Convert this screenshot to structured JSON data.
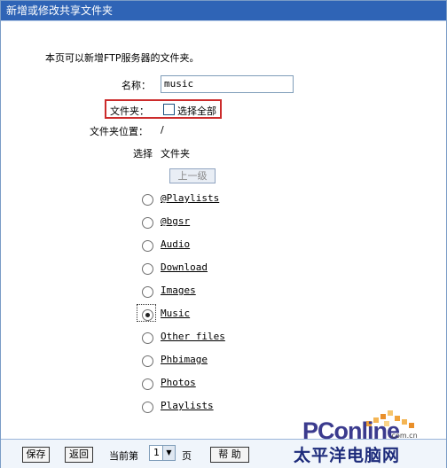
{
  "window": {
    "title": "新增或修改共享文件夹"
  },
  "intro": "本页可以新增FTP服务器的文件夹。",
  "form": {
    "name_label": "名称：",
    "name_value": "music",
    "folder_label": "文件夹：",
    "select_all_label": "选择全部",
    "location_label": "文件夹位置：",
    "location_value": "/"
  },
  "list": {
    "col_select": "选择",
    "col_folder": "文件夹",
    "up_button": "上一级",
    "items": [
      {
        "label": "@Playlists",
        "selected": false
      },
      {
        "label": "@bgsr",
        "selected": false
      },
      {
        "label": "Audio",
        "selected": false
      },
      {
        "label": "Download",
        "selected": false
      },
      {
        "label": "Images",
        "selected": false
      },
      {
        "label": "Music",
        "selected": true
      },
      {
        "label": "Other files",
        "selected": false
      },
      {
        "label": "Phbimage",
        "selected": false
      },
      {
        "label": "Photos",
        "selected": false
      },
      {
        "label": "Playlists",
        "selected": false
      }
    ]
  },
  "footer": {
    "save_label": "保存",
    "back_label": "返回",
    "current_page_label": "当前第",
    "page_value": "1",
    "page_unit": "页",
    "help_label": "帮 助"
  },
  "watermark": {
    "brand": "PConline",
    "domain": ".com.cn",
    "cn_name": "太平洋电脑网"
  },
  "colors": {
    "titlebar": "#2f64b6",
    "highlight_border": "#cc2b2b",
    "footer_bg": "#f0f5fb"
  }
}
